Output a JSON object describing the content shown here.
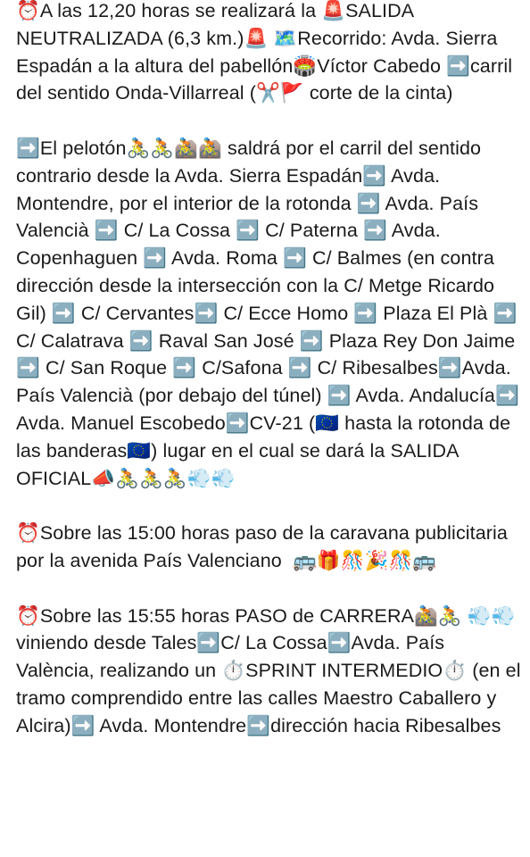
{
  "message": {
    "paragraphs": [
      "⏰A las 12,20 horas se realizará la 🚨SALIDA NEUTRALIZADA (6,3 km.)🚨 🗺️Recorrido: Avda. Sierra Espadán a la altura del pabellón🏟️Víctor Cabedo ➡️carril del sentido Onda-Villarreal (✂️🚩 corte de la cinta)",
      "➡️El pelotón🚴🚴🚵🚵 saldrá por el carril del sentido contrario desde la Avda. Sierra Espadán➡️ Avda. Montendre, por el interior de la rotonda ➡️ Avda. País Valencià ➡️ C/ La Cossa ➡️ C/ Paterna ➡️ Avda. Copenhaguen ➡️ Avda. Roma ➡️ C/ Balmes (en contra dirección desde la intersección con la C/ Metge Ricardo Gil) ➡️ C/ Cervantes➡️ C/ Ecce Homo ➡️ Plaza El Plà ➡️ C/ Calatrava ➡️ Raval San José ➡️ Plaza Rey Don Jaime ➡️ C/ San Roque ➡️ C/Safona ➡️ C/ Ribesalbes➡️Avda. País Valencià (por debajo del túnel) ➡️ Avda. Andalucía➡️ Avda. Manuel Escobedo➡️CV-21 (🇪🇺 hasta la rotonda de las banderas🇪🇺) lugar en el cual se dará la SALIDA OFICIAL📣🚴🚴🚴💨💨",
      "⏰Sobre las 15:00 horas paso de la caravana publicitaria por la avenida País Valenciano  🚌🎁🎊🎉🎊🚌",
      "⏰Sobre las 15:55 horas PASO de CARRERA🚵🚴 💨💨 viniendo desde Tales➡️C/ La Cossa➡️Avda. País València, realizando un ⏱️SPRINT INTERMEDIO⏱️ (en el tramo comprendido entre las calles Maestro Caballero y Alcira)➡️ Avda. Montendre➡️dirección hacia Ribesalbes"
    ]
  }
}
